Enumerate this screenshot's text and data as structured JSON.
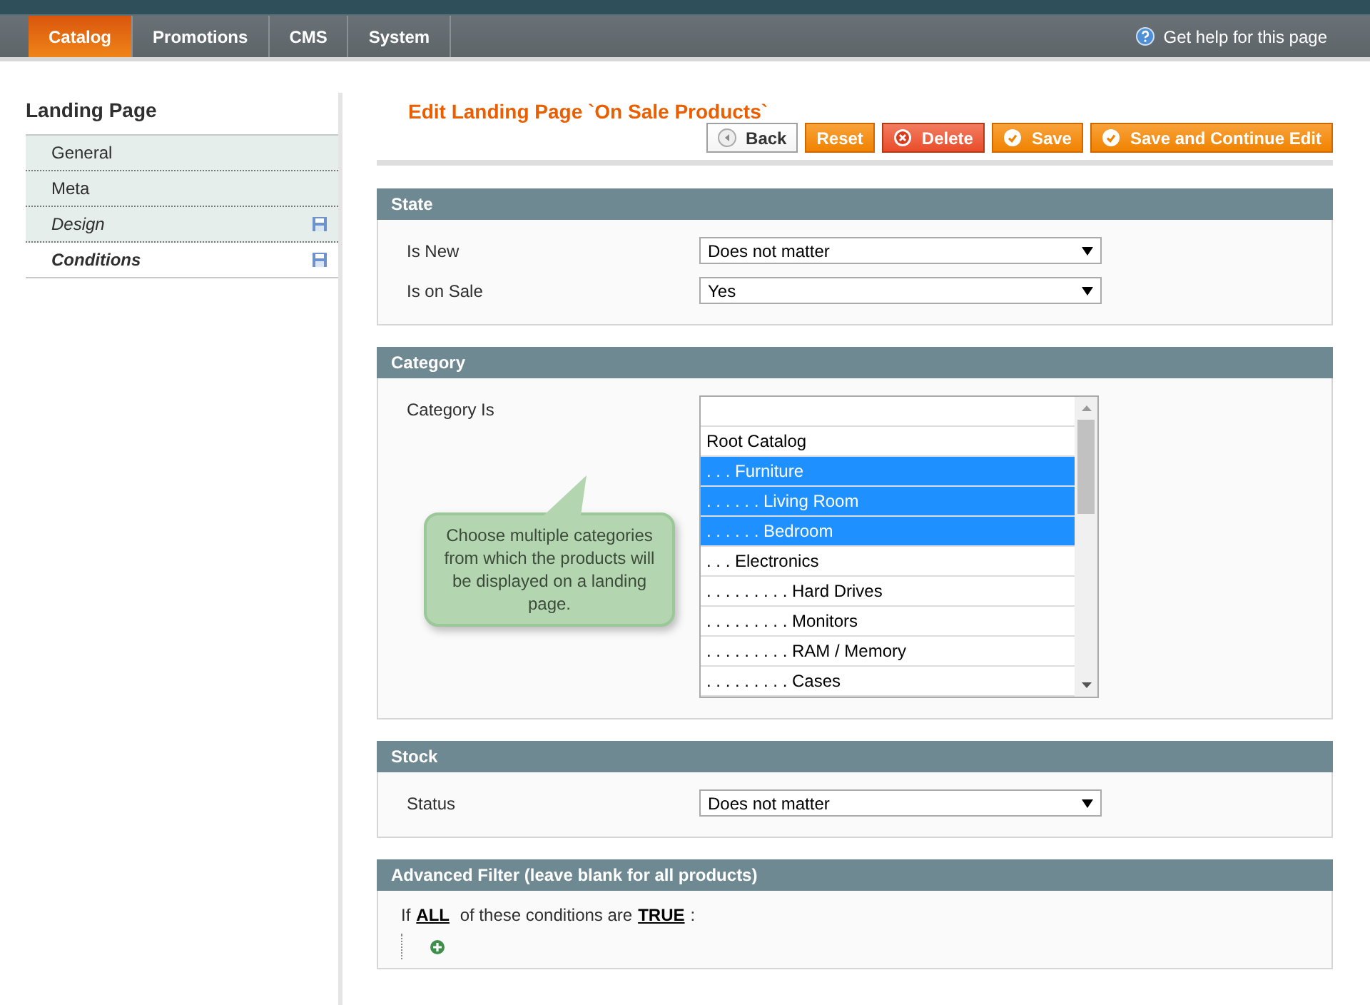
{
  "nav": {
    "tabs": [
      {
        "label": "Catalog",
        "selected": true
      },
      {
        "label": "Promotions",
        "selected": false
      },
      {
        "label": "CMS",
        "selected": false
      },
      {
        "label": "System",
        "selected": false
      }
    ],
    "help": "Get help for this page"
  },
  "sidebar": {
    "title": "Landing Page",
    "items": [
      {
        "label": "General",
        "selected": false,
        "changed": false
      },
      {
        "label": "Meta",
        "selected": false,
        "changed": false
      },
      {
        "label": "Design",
        "selected": false,
        "changed": true
      },
      {
        "label": "Conditions",
        "selected": true,
        "changed": true
      }
    ]
  },
  "page_title": "Edit Landing Page `On Sale Products`",
  "buttons": [
    {
      "label": "Back",
      "kind": "back"
    },
    {
      "label": "Reset",
      "kind": "plain"
    },
    {
      "label": "Delete",
      "kind": "delete"
    },
    {
      "label": "Save",
      "kind": "save"
    },
    {
      "label": "Save and Continue Edit",
      "kind": "save"
    }
  ],
  "sections": [
    {
      "title": "State",
      "fields": [
        {
          "label": "Is New",
          "kind": "select",
          "value": "Does not matter"
        },
        {
          "label": "Is on Sale",
          "kind": "select",
          "value": "Yes"
        }
      ]
    },
    {
      "title": "Category",
      "fields": [
        {
          "label": "Category Is",
          "kind": "multiselect",
          "options": [
            {
              "label": "Root Catalog",
              "selected": false
            },
            {
              "label": ". . . Furniture",
              "selected": true
            },
            {
              "label": ". . . . . . Living Room",
              "selected": true
            },
            {
              "label": ". . . . . . Bedroom",
              "selected": true
            },
            {
              "label": ". . . Electronics",
              "selected": false
            },
            {
              "label": ". . . . . . . . . Hard Drives",
              "selected": false
            },
            {
              "label": ". . . . . . . . . Monitors",
              "selected": false
            },
            {
              "label": ". . . . . . . . . RAM / Memory",
              "selected": false
            },
            {
              "label": ". . . . . . . . . Cases",
              "selected": false
            }
          ],
          "tooltip": "Choose multiple categories from which the products will be displayed on a landing page."
        }
      ]
    },
    {
      "title": "Stock",
      "fields": [
        {
          "label": "Status",
          "kind": "select",
          "value": "Does not matter"
        }
      ]
    },
    {
      "title": "Advanced Filter (leave blank for all products)",
      "fields": [
        {
          "kind": "condition",
          "prefix": "If",
          "aggregator": "ALL",
          "middle": "of these conditions are",
          "value": "TRUE",
          "suffix": ":"
        }
      ]
    }
  ]
}
